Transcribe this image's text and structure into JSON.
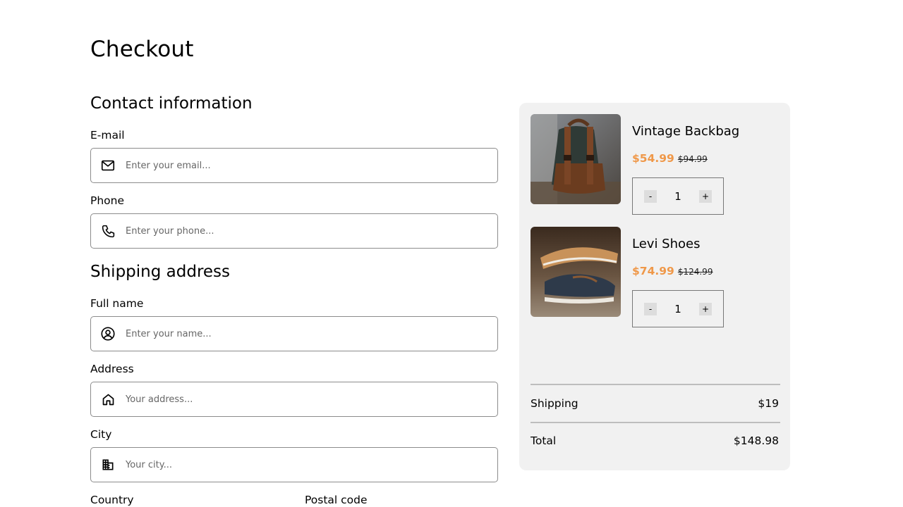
{
  "page": {
    "title": "Checkout"
  },
  "contact": {
    "heading": "Contact information",
    "email": {
      "label": "E-mail",
      "placeholder": "Enter your email..."
    },
    "phone": {
      "label": "Phone",
      "placeholder": "Enter your phone..."
    }
  },
  "shipping": {
    "heading": "Shipping address",
    "full_name": {
      "label": "Full name",
      "placeholder": "Enter your name..."
    },
    "address": {
      "label": "Address",
      "placeholder": "Your address..."
    },
    "city": {
      "label": "City",
      "placeholder": "Your city..."
    },
    "country": {
      "label": "Country"
    },
    "postal_code": {
      "label": "Postal code"
    }
  },
  "cart": {
    "items": [
      {
        "name": "Vintage Backbag",
        "price": "$54.99",
        "old_price": "$94.99",
        "quantity": "1",
        "minus": "-",
        "plus": "+",
        "image": "backpack-photo"
      },
      {
        "name": "Levi Shoes",
        "price": "$74.99",
        "old_price": "$124.99",
        "quantity": "1",
        "minus": "-",
        "plus": "+",
        "image": "shoes-photo"
      }
    ],
    "shipping_label": "Shipping",
    "shipping_value": "$19",
    "total_label": "Total",
    "total_value": "$148.98"
  },
  "colors": {
    "accent_price": "#ef9849",
    "panel_bg": "#f1f1f1"
  }
}
